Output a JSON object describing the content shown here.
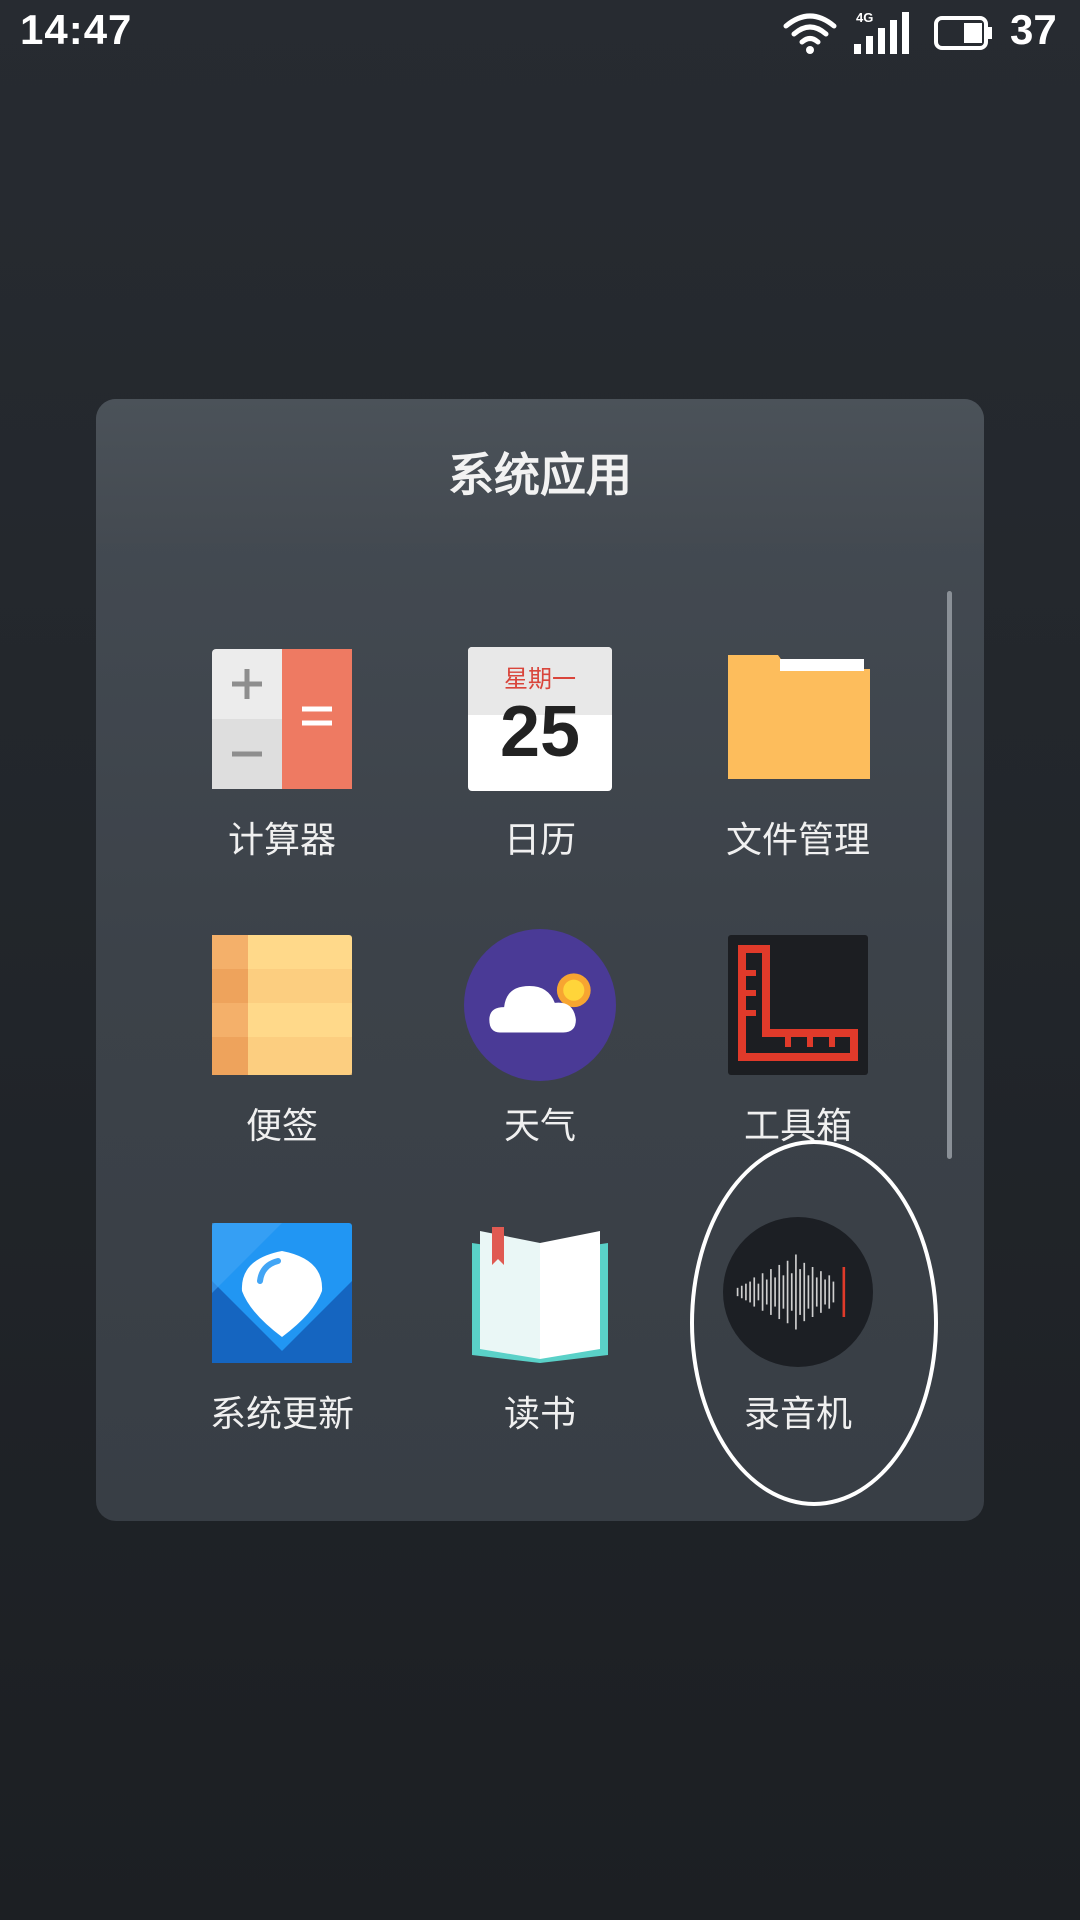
{
  "status_bar": {
    "time": "14:47",
    "network_type": "4G",
    "battery_level": "37",
    "icons": [
      "wifi-icon",
      "signal-icon",
      "battery-icon"
    ]
  },
  "folder": {
    "title": "系统应用",
    "apps": [
      {
        "label": "计算器",
        "icon": "calculator-icon"
      },
      {
        "label": "日历",
        "icon": "calendar-icon",
        "weekday": "星期一",
        "day": "25"
      },
      {
        "label": "文件管理",
        "icon": "folder-icon"
      },
      {
        "label": "便签",
        "icon": "notes-icon"
      },
      {
        "label": "天气",
        "icon": "weather-icon"
      },
      {
        "label": "工具箱",
        "icon": "toolbox-icon"
      },
      {
        "label": "系统更新",
        "icon": "system-update-icon"
      },
      {
        "label": "读书",
        "icon": "book-icon"
      },
      {
        "label": "录音机",
        "icon": "recorder-icon"
      }
    ]
  },
  "colors": {
    "calculator_accent": "#ee7a62",
    "calendar_red": "#d9453b",
    "folder_yellow": "#fdbd5c",
    "notes_yellow": "#ffd98a",
    "weather_purple": "#4a3a96",
    "toolbox_red": "#e03a2a",
    "update_blue": "#2196f3",
    "book_teal": "#5ad1c8",
    "recorder_dark": "#1c1f24"
  }
}
